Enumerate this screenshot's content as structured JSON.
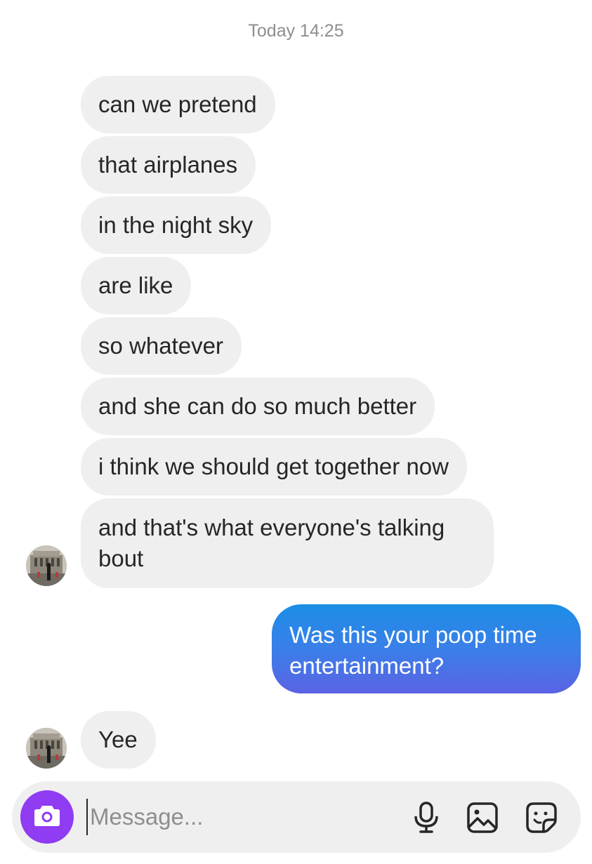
{
  "chat": {
    "timestamp": "Today 14:25",
    "incoming_group_1": [
      "can we pretend",
      "that airplanes",
      "in the night sky",
      "are like",
      "so whatever",
      "and she can do so much better",
      "i think we should get together now",
      "and that's what everyone's talking bout"
    ],
    "outgoing_message": "Was this your poop time entertainment?",
    "incoming_reply": "Yee"
  },
  "composer": {
    "placeholder": "Message...",
    "icons": [
      "camera-icon",
      "microphone-icon",
      "gallery-icon",
      "sticker-icon"
    ]
  },
  "colors": {
    "incoming_bubble": "#efefef",
    "outgoing_gradient_top": "#1b8ee6",
    "outgoing_gradient_bottom": "#5b63e4",
    "camera_button": "#8f3cf2",
    "timestamp": "#8e8e8e"
  }
}
